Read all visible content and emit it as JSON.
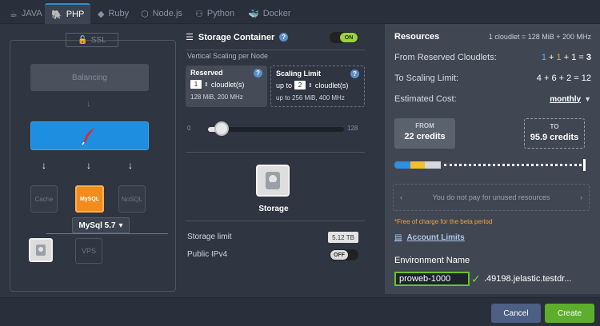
{
  "tabs": [
    {
      "label": "JAVA",
      "icon": "java-icon"
    },
    {
      "label": "PHP",
      "icon": "php-icon"
    },
    {
      "label": "Ruby",
      "icon": "ruby-icon"
    },
    {
      "label": "Node.js",
      "icon": "nodejs-icon"
    },
    {
      "label": "Python",
      "icon": "python-icon"
    },
    {
      "label": "Docker",
      "icon": "docker-icon"
    }
  ],
  "active_tab": "PHP",
  "topology": {
    "ssl_label": "SSL",
    "balancing_label": "Balancing",
    "cache_label": "Cache",
    "mysql_badge": "MySQL",
    "nosql_label": "NoSQL",
    "mysql_version": "MySql 5.7",
    "vps_label": "VPS"
  },
  "storage": {
    "title": "Storage Container",
    "toggle": "ON",
    "vertical_scaling_label": "Vertical Scaling per Node",
    "reserved": {
      "title": "Reserved",
      "count": "1",
      "unit": "cloudlet(s)",
      "sub": "128 MiB, 200 MHz"
    },
    "limit": {
      "title": "Scaling Limit",
      "prefix": "up to",
      "count": "2",
      "unit": "cloudlet(s)",
      "sub": "up to 256 MiB, 400 MHz"
    },
    "slider_min": "0",
    "slider_max": "128",
    "node_label": "Storage",
    "storage_limit_label": "Storage limit",
    "storage_limit_value": "5.12 TB",
    "public_ipv4_label": "Public IPv4",
    "public_ipv4_toggle": "OFF"
  },
  "resources": {
    "title": "Resources",
    "cloudlet_info": "1 cloudlet = 128 MiB + 200 MHz",
    "from_reserved_label": "From Reserved Cloudlets:",
    "from_reserved_parts": [
      "1",
      "+",
      "1",
      "+",
      "1",
      "=",
      "3"
    ],
    "to_limit_label": "To Scaling Limit:",
    "to_limit_eq": "4 + 6 + 2 = 12",
    "estimated_cost_label": "Estimated Cost:",
    "period": "monthly",
    "from_label": "FROM",
    "from_value": "22 credits",
    "to_label": "TO",
    "to_value": "95.9 credits",
    "carousel_text": "You do not pay for unused resources",
    "free_note": "*Free of charge for the beta period",
    "account_limits": "Account Limits",
    "env_name_label": "Environment Name",
    "env_name_value": "proweb-1000",
    "env_domain": ".49198.jelastic.testdr..."
  },
  "footer": {
    "cancel": "Cancel",
    "create": "Create"
  },
  "colors": {
    "accent_blue": "#1e8fe0",
    "create_green": "#5dae2c",
    "mysql_orange": "#f28c1c"
  }
}
